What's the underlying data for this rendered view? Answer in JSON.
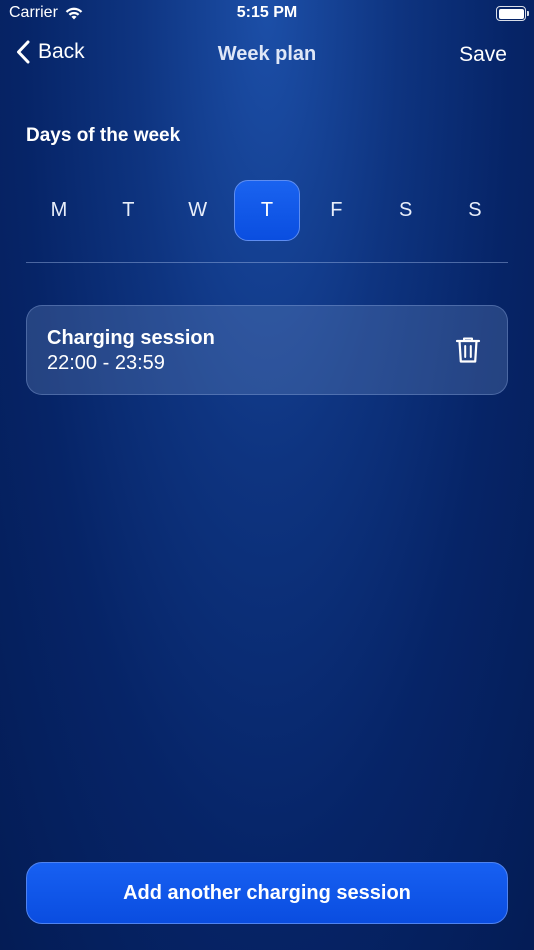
{
  "status_bar": {
    "carrier": "Carrier",
    "time": "5:15 PM"
  },
  "nav": {
    "back_label": "Back",
    "title": "Week plan",
    "save_label": "Save"
  },
  "days_section": {
    "title": "Days of the week",
    "days": [
      {
        "label": "M",
        "selected": false
      },
      {
        "label": "T",
        "selected": false
      },
      {
        "label": "W",
        "selected": false
      },
      {
        "label": "T",
        "selected": true
      },
      {
        "label": "F",
        "selected": false
      },
      {
        "label": "S",
        "selected": false
      },
      {
        "label": "S",
        "selected": false
      }
    ]
  },
  "sessions": [
    {
      "title": "Charging session",
      "time_range": "22:00 - 23:59"
    }
  ],
  "add_button_label": "Add another charging session",
  "colors": {
    "accent": "#0a4ee0",
    "background_top": "#1c4fa8",
    "background_bottom": "#041c55"
  },
  "icons": {
    "wifi": "wifi-icon",
    "battery": "battery-icon",
    "back": "chevron-left-icon",
    "delete": "trash-icon"
  }
}
